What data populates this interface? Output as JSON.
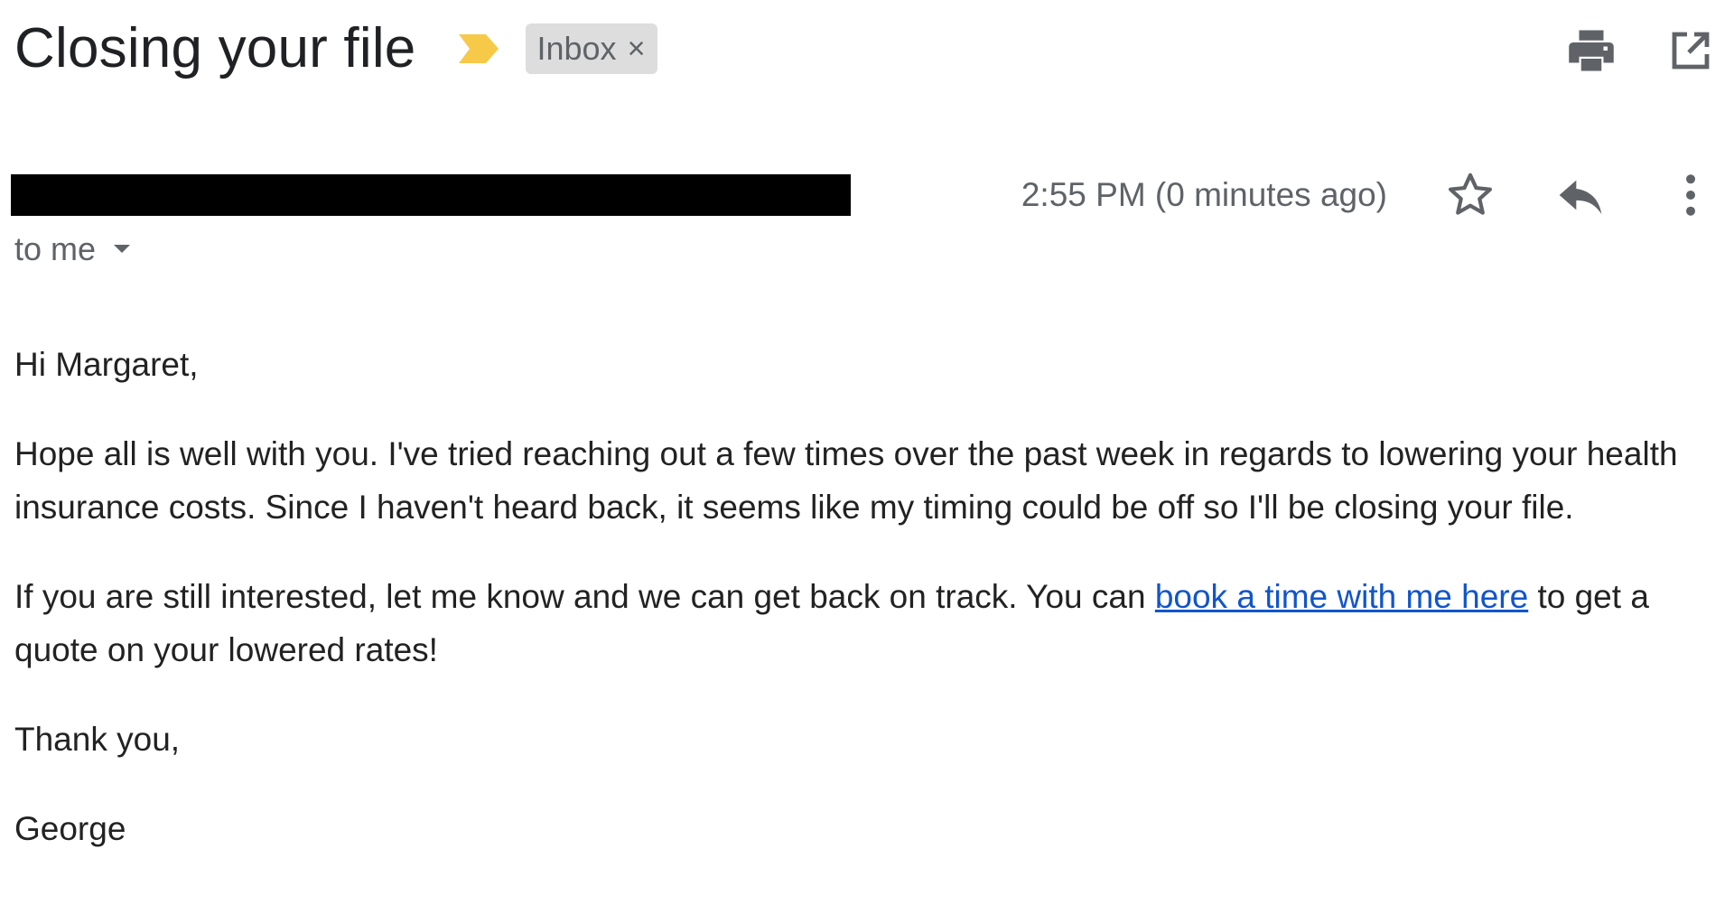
{
  "subject": {
    "title": "Closing your file",
    "importance_icon": "importance-marker-icon",
    "label": "Inbox",
    "label_remove": "×"
  },
  "header_actions": {
    "print_icon": "print-icon",
    "open_new_window_icon": "open-in-new-window-icon"
  },
  "message": {
    "recipient_text": "to me",
    "timestamp": "2:55 PM (0 minutes ago)",
    "star_icon": "star-outline-icon",
    "reply_icon": "reply-icon",
    "more_icon": "more-vert-icon",
    "body": {
      "greeting": "Hi Margaret,",
      "paragraph1": "Hope all is well with you. I've tried reaching out a few times over the past week in regards to lowering your health insurance costs. Since I haven't heard back, it seems like my timing could be off so I'll be closing your file.",
      "paragraph2_before_link": "If you are still interested, let me know and we can get back on track. You can ",
      "paragraph2_link": "book a time with me here",
      "paragraph2_after_link": " to get a quote on your lowered rates!",
      "closing": "Thank you,",
      "signature": "George"
    }
  },
  "colors": {
    "importance_marker": "#f7c948",
    "link": "#1155cc",
    "chip_background": "#dddddd",
    "redaction": "#000000"
  }
}
